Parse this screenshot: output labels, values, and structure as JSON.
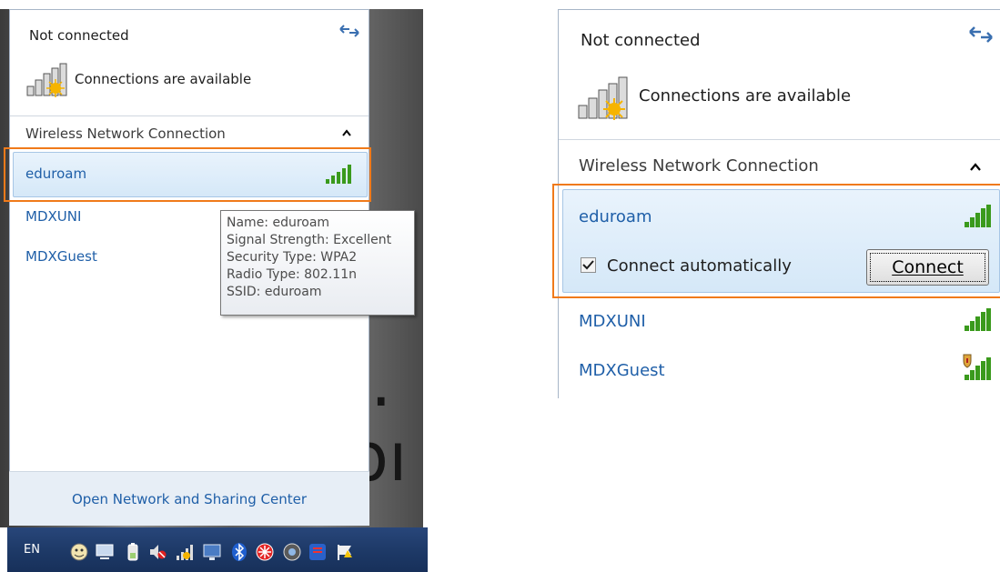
{
  "left": {
    "status": "Not connected",
    "available": "Connections are available",
    "section_title": "Wireless Network Connection",
    "networks": [
      "eduroam",
      "MDXUNI",
      "MDXGuest"
    ],
    "tooltip": {
      "name": "Name: eduroam",
      "signal": "Signal Strength: Excellent",
      "security": "Security Type: WPA2",
      "radio": "Radio Type: 802.11n",
      "ssid": "SSID: eduroam"
    },
    "footer_link": "Open Network and Sharing Center",
    "background_text": [
      "d.",
      "pı"
    ],
    "taskbar": {
      "language": "EN",
      "tray_icons": [
        "messenger-icon",
        "monitor-icon",
        "battery-icon",
        "volume-muted-icon",
        "network-icon",
        "display-icon",
        "bluetooth-icon",
        "antivirus-icon",
        "media-icon",
        "security-icon",
        "flag-icon"
      ]
    }
  },
  "right": {
    "status": "Not connected",
    "available": "Connections are available",
    "section_title": "Wireless Network Connection",
    "selected_network": "eduroam",
    "connect_auto_label": "Connect automatically",
    "connect_auto_checked": true,
    "connect_button": "Connect",
    "networks": [
      "MDXUNI",
      "MDXGuest"
    ]
  },
  "colors": {
    "highlight_border": "#f07a1a",
    "network_link": "#1f5fa8",
    "signal_green": "#3a9a1c",
    "taskbar": "#1e3a68"
  }
}
